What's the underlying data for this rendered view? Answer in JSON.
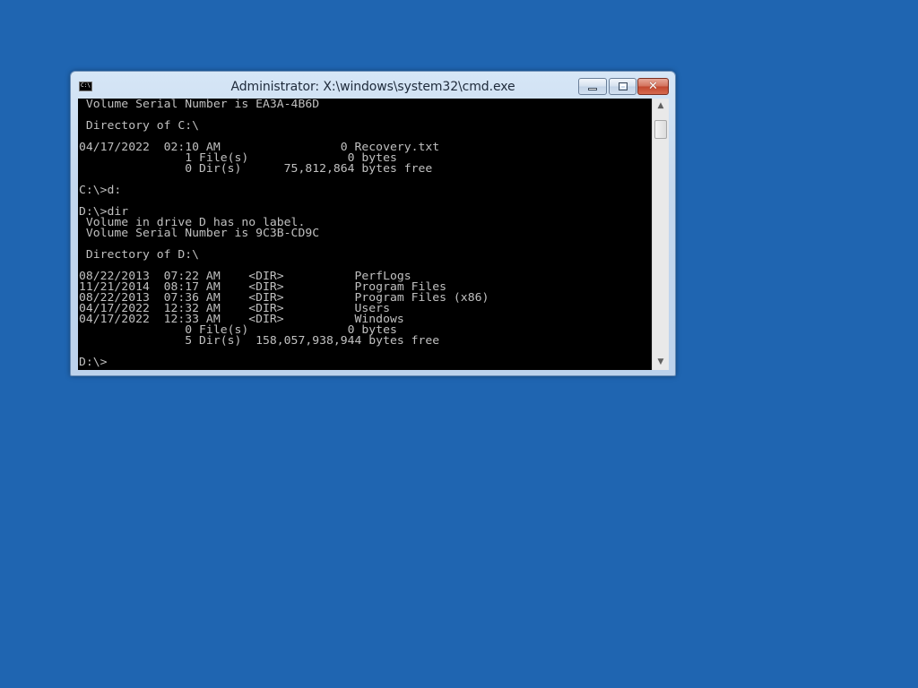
{
  "window": {
    "title": "Administrator: X:\\windows\\system32\\cmd.exe",
    "icon_text": "C:\\"
  },
  "controls": {
    "minimize_icon": "minimize-icon",
    "maximize_icon": "maximize-icon",
    "close_icon": "close-icon",
    "close_glyph": "✕"
  },
  "console": {
    "lines": [
      " Volume Serial Number is EA3A-4B6D",
      "",
      " Directory of C:\\",
      "",
      "04/17/2022  02:10 AM                 0 Recovery.txt",
      "               1 File(s)              0 bytes",
      "               0 Dir(s)      75,812,864 bytes free",
      "",
      "C:\\>d:",
      "",
      "D:\\>dir",
      " Volume in drive D has no label.",
      " Volume Serial Number is 9C3B-CD9C",
      "",
      " Directory of D:\\",
      "",
      "08/22/2013  07:22 AM    <DIR>          PerfLogs",
      "11/21/2014  08:17 AM    <DIR>          Program Files",
      "08/22/2013  07:36 AM    <DIR>          Program Files (x86)",
      "04/17/2022  12:32 AM    <DIR>          Users",
      "04/17/2022  12:33 AM    <DIR>          Windows",
      "               0 File(s)              0 bytes",
      "               5 Dir(s)  158,057,938,944 bytes free",
      "",
      "D:\\>"
    ]
  },
  "scrollbar": {
    "up_arrow": "▲",
    "down_arrow": "▼"
  },
  "colors": {
    "desktop": "#1f65b1",
    "console_bg": "#000000",
    "console_text": "#c0c0c0"
  }
}
